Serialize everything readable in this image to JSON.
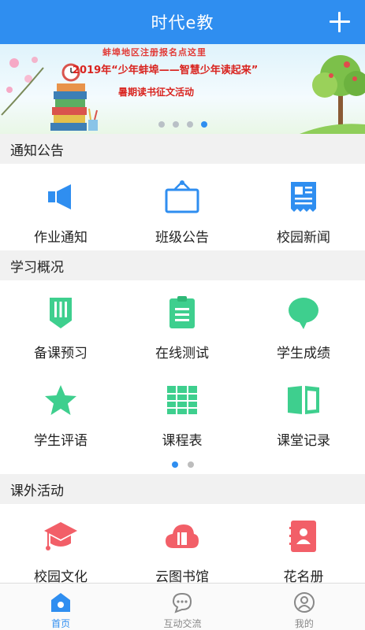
{
  "header": {
    "title": "时代e教"
  },
  "banner": {
    "top_line": "蚌埠地区注册报名点这里",
    "main_line": "2019年“少年蚌埠——智慧少年读起来”",
    "sub_line": "暑期读书征文活动",
    "slides": 4,
    "active_slide": 4
  },
  "sections": {
    "notice": {
      "title": "通知公告",
      "items": [
        {
          "label": "作业通知",
          "icon": "megaphone-icon"
        },
        {
          "label": "班级公告",
          "icon": "notice-board-icon"
        },
        {
          "label": "校园新闻",
          "icon": "newspaper-icon"
        }
      ]
    },
    "study": {
      "title": "学习概况",
      "items": [
        {
          "label": "备课预习",
          "icon": "pencil-icon"
        },
        {
          "label": "在线测试",
          "icon": "clipboard-icon"
        },
        {
          "label": "学生成绩",
          "icon": "chat-bubble-icon"
        },
        {
          "label": "学生评语",
          "icon": "star-icon"
        },
        {
          "label": "课程表",
          "icon": "timetable-icon"
        },
        {
          "label": "课堂记录",
          "icon": "book-icon"
        }
      ],
      "pages": 2,
      "active_page": 1
    },
    "activity": {
      "title": "课外活动",
      "items": [
        {
          "label": "校园文化",
          "icon": "graduation-cap-icon"
        },
        {
          "label": "云图书馆",
          "icon": "cloud-library-icon"
        },
        {
          "label": "花名册",
          "icon": "roster-icon"
        }
      ]
    }
  },
  "tabbar": {
    "tabs": [
      {
        "label": "首页",
        "icon": "home-icon",
        "active": true
      },
      {
        "label": "互动交流",
        "icon": "message-icon",
        "active": false
      },
      {
        "label": "我的",
        "icon": "profile-icon",
        "active": false
      }
    ]
  },
  "colors": {
    "primary": "#2f8ef0",
    "notice_icon": "#2f8ef0",
    "study_icon": "#3ecf8e",
    "activity_icon": "#f25f68"
  }
}
